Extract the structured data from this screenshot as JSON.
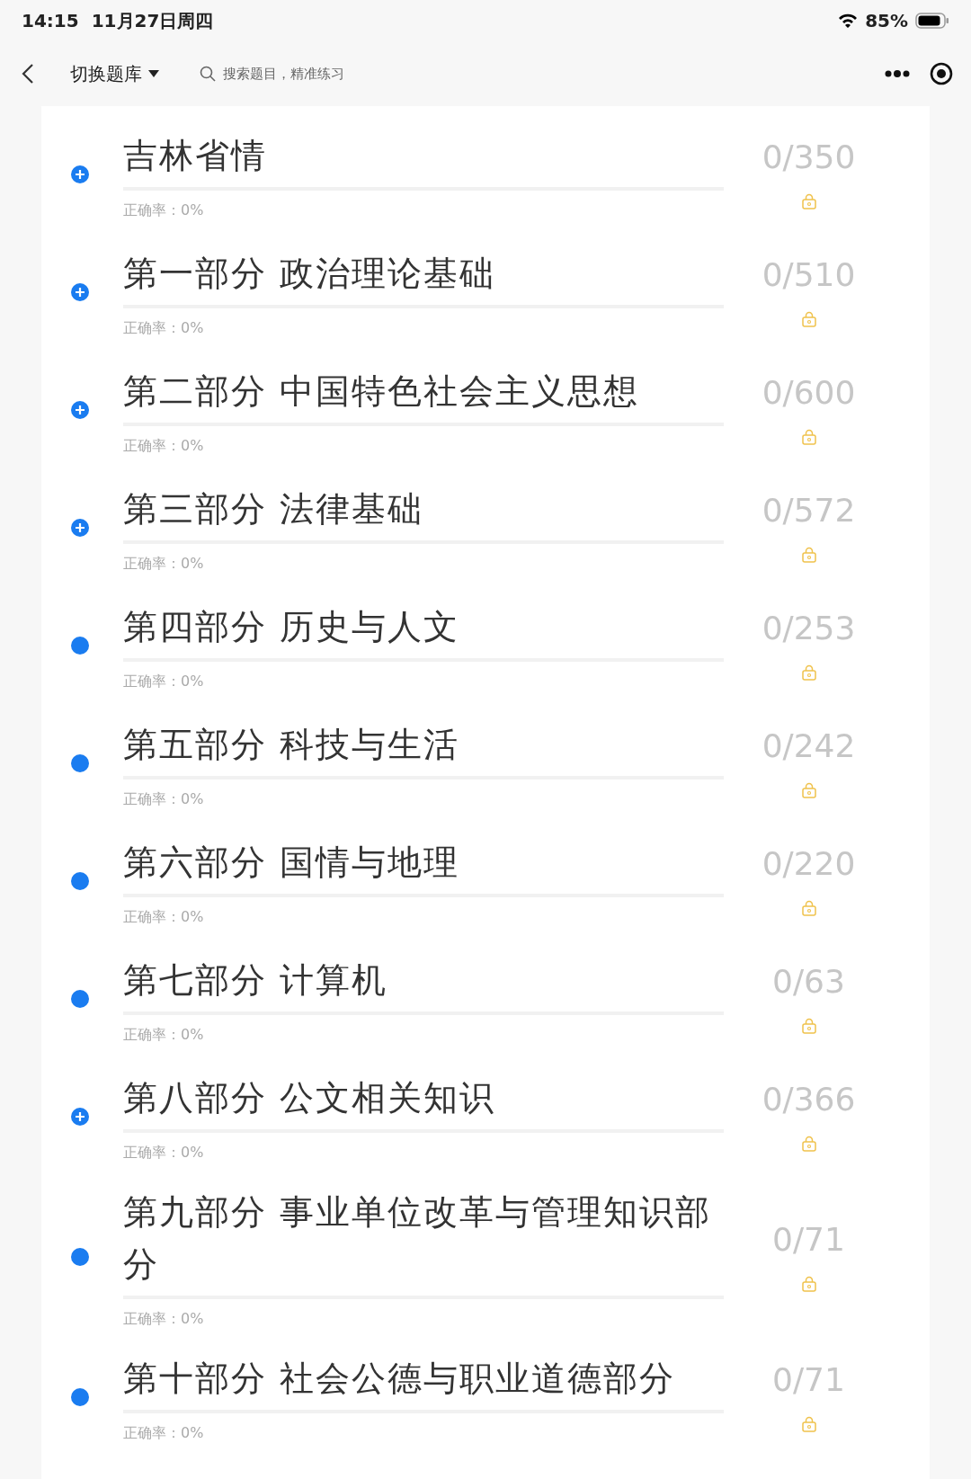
{
  "status_bar": {
    "time": "14:15",
    "date": "11月27日周四",
    "battery": "85%"
  },
  "nav": {
    "title": "切换题库",
    "search": {
      "placeholder": "搜索题目，精准练习"
    }
  },
  "sections": [
    {
      "title": "吉林省情",
      "kind": "expandable",
      "count": "0/350",
      "accuracy": "正确率：0%",
      "level": 0
    },
    {
      "title": "第一部分 政治理论基础",
      "kind": "expandable",
      "count": "0/510",
      "accuracy": "正确率：0%",
      "level": 0
    },
    {
      "title": "第二部分 中国特色社会主义思想",
      "kind": "expandable",
      "count": "0/600",
      "accuracy": "正确率：0%",
      "level": 0
    },
    {
      "title": "第三部分 法律基础",
      "kind": "expandable",
      "count": "0/572",
      "accuracy": "正确率：0%",
      "level": 0
    },
    {
      "title": "第四部分 历史与人文",
      "kind": "leaf",
      "count": "0/253",
      "accuracy": "正确率：0%",
      "level": 0
    },
    {
      "title": "第五部分 科技与生活",
      "kind": "leaf",
      "count": "0/242",
      "accuracy": "正确率：0%",
      "level": 0
    },
    {
      "title": "第六部分 国情与地理",
      "kind": "leaf",
      "count": "0/220",
      "accuracy": "正确率：0%",
      "level": 0
    },
    {
      "title": "第七部分 计算机",
      "kind": "leaf",
      "count": "0/63",
      "accuracy": "正确率：0%",
      "level": 0
    },
    {
      "title": "第八部分 公文相关知识",
      "kind": "expandable",
      "count": "0/366",
      "accuracy": "正确率：0%",
      "level": 0
    },
    {
      "title": "第九部分 事业单位改革与管理知识部分",
      "kind": "leaf",
      "count": "0/71",
      "accuracy": "正确率：0%",
      "level": 0
    },
    {
      "title": "第十部分 社会公德与职业道德部分",
      "kind": "leaf",
      "count": "0/71",
      "accuracy": "正确率：0%",
      "level": 0
    }
  ]
}
